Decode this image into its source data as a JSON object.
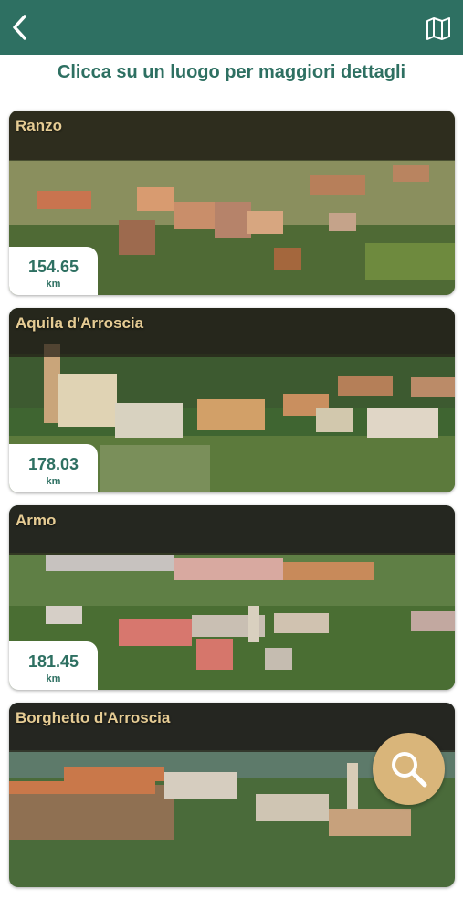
{
  "header": {
    "back_icon": "chevron-left-icon",
    "map_icon": "map-icon",
    "color": "#2e7062"
  },
  "subtitle": "Clicca su un luogo per maggiori dettagli",
  "places": [
    {
      "name": "Ranzo",
      "distance": "154.65",
      "unit": "km"
    },
    {
      "name": "Aquila d'Arroscia",
      "distance": "178.03",
      "unit": "km"
    },
    {
      "name": "Armo",
      "distance": "181.45",
      "unit": "km"
    },
    {
      "name": "Borghetto d'Arroscia"
    }
  ],
  "search_button": {
    "icon": "search-icon",
    "color": "#d9b57a"
  }
}
